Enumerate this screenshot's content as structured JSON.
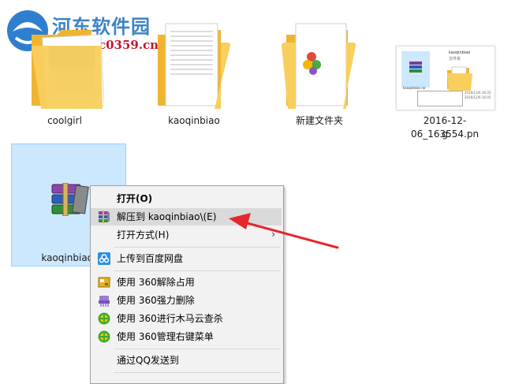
{
  "watermark": {
    "title": "河东软件园",
    "url": "www.pc0359.cn"
  },
  "files": [
    {
      "name": "coolgirl",
      "type": "folder"
    },
    {
      "name": "kaoqinbiao",
      "type": "folder"
    },
    {
      "name": "新建文件夹",
      "type": "folder"
    },
    {
      "name_line1": "2016-12-06_163554.pn",
      "name_line2": "g",
      "type": "png",
      "thumb_text": {
        "t1": "kaoqinbiao",
        "t2": "文件夹",
        "t3": "kaoqinbiao.rar",
        "t4": "2016/12/6 16:35",
        "t5": "2016/12/6 16:05"
      }
    },
    {
      "name": "kaoqinbiao.",
      "type": "rar",
      "selected": true
    }
  ],
  "context_menu": {
    "items": [
      {
        "label": "打开(O)",
        "bold": true
      },
      {
        "label": "解压到 kaoqinbiao\\(E)",
        "icon": "winrar-icon",
        "highlighted": true
      },
      {
        "label": "打开方式(H)",
        "submenu": true,
        "arrow": "›"
      },
      {
        "label": "上传到百度网盘",
        "icon": "baidu-netdisk-icon"
      },
      {
        "label": "使用 360解除占用",
        "icon": "360-unlock-icon"
      },
      {
        "label": "使用 360强力删除",
        "icon": "360-shred-icon"
      },
      {
        "label": "使用 360进行木马云查杀",
        "icon": "360-scan-icon"
      },
      {
        "label": "使用 360管理右键菜单",
        "icon": "360-menu-icon"
      },
      {
        "label": "通过QQ发送到",
        "icon": ""
      }
    ]
  },
  "colors": {
    "selection_bg": "#cce8ff",
    "menu_bg": "#f2f2f2",
    "arrow": "#e5282c",
    "folder": "#f4c24e"
  }
}
